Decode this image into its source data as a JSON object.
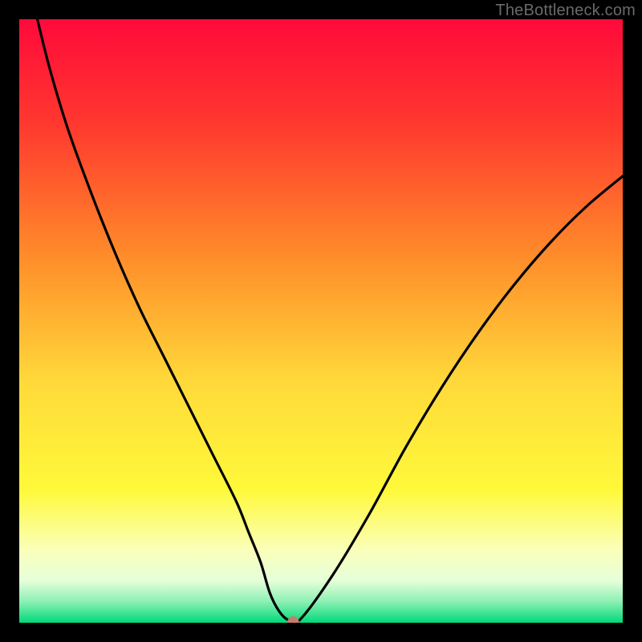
{
  "watermark": "TheBottleneck.com",
  "chart_data": {
    "type": "line",
    "title": "",
    "xlabel": "",
    "ylabel": "",
    "xlim": [
      0,
      100
    ],
    "ylim": [
      0,
      100
    ],
    "gradient_stops": [
      {
        "offset": 0,
        "color": "#ff0a3a"
      },
      {
        "offset": 0.18,
        "color": "#ff3a2e"
      },
      {
        "offset": 0.4,
        "color": "#ff8f2a"
      },
      {
        "offset": 0.6,
        "color": "#ffd93a"
      },
      {
        "offset": 0.78,
        "color": "#fff93a"
      },
      {
        "offset": 0.88,
        "color": "#faffba"
      },
      {
        "offset": 0.93,
        "color": "#e6ffda"
      },
      {
        "offset": 0.965,
        "color": "#8cf0b4"
      },
      {
        "offset": 1.0,
        "color": "#00d978"
      }
    ],
    "series": [
      {
        "name": "bottleneck-curve",
        "x": [
          3,
          5,
          8,
          12,
          16,
          20,
          24,
          28,
          32,
          36,
          38,
          40,
          41.5,
          43,
          44.5,
          46.5,
          52,
          58,
          64,
          70,
          76,
          82,
          88,
          94,
          100
        ],
        "y": [
          100,
          92,
          82,
          71,
          61,
          52,
          44,
          36,
          28,
          20,
          15,
          10,
          5,
          2,
          0.5,
          0.5,
          8,
          18,
          29,
          39,
          48,
          56,
          63,
          69,
          74
        ]
      }
    ],
    "marker": {
      "x": 45.4,
      "y": 0.1,
      "r_pct": 0.9
    },
    "legend": null,
    "annotations": []
  }
}
